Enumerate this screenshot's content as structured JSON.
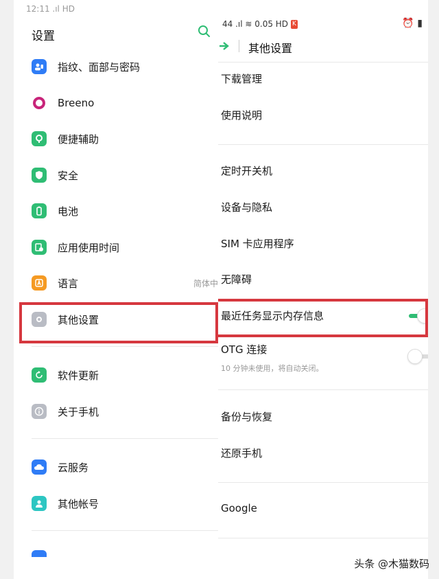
{
  "left": {
    "status": "12:11  .ıl HD",
    "title": "设置",
    "icons": {
      "search": "search-icon"
    },
    "items": [
      {
        "label": "指纹、面部与密码",
        "icon": "fingerprint-icon",
        "color": "#2f7cf6"
      },
      {
        "label": "Breeno",
        "icon": "breeno-icon",
        "color": "#c8247a"
      },
      {
        "label": "便捷辅助",
        "icon": "assist-icon",
        "color": "#2fbd74"
      },
      {
        "label": "安全",
        "icon": "shield-icon",
        "color": "#2fbd74"
      },
      {
        "label": "电池",
        "icon": "battery-icon",
        "color": "#2fbd74"
      },
      {
        "label": "应用使用时间",
        "icon": "clock-icon",
        "color": "#2fbd74"
      },
      {
        "label": "语言",
        "icon": "language-icon",
        "color": "#f59a23",
        "value": "简体中"
      },
      {
        "label": "其他设置",
        "icon": "more-settings-icon",
        "color": "#b9bcc4"
      },
      {
        "label": "软件更新",
        "icon": "update-icon",
        "color": "#2fbd74"
      },
      {
        "label": "关于手机",
        "icon": "info-icon",
        "color": "#b9bcc4"
      },
      {
        "label": "云服务",
        "icon": "cloud-icon",
        "color": "#2f7cf6"
      },
      {
        "label": "其他帐号",
        "icon": "account-icon",
        "color": "#2dc6c2"
      }
    ]
  },
  "right": {
    "status": "44 .ıl ≋ 0.05 HD",
    "hd_badge": "K",
    "corner": "⏰ ▮",
    "title": "其他设置",
    "items": [
      {
        "label": "下载管理"
      },
      {
        "label": "使用说明"
      },
      {
        "label": "定时开关机"
      },
      {
        "label": "设备与隐私"
      },
      {
        "label": "SIM 卡应用程序"
      },
      {
        "label": "无障碍"
      },
      {
        "label": "最近任务显示内存信息",
        "toggle": "on"
      },
      {
        "label": "OTG 连接",
        "sub": "10 分钟未使用，将自动关闭。",
        "toggle": "off"
      },
      {
        "label": "备份与恢复"
      },
      {
        "label": "还原手机"
      },
      {
        "label": "Google"
      }
    ]
  },
  "watermark": "头条 @木猫数码",
  "accent_green": "#2fbd74",
  "highlight_color": "#d6383f"
}
